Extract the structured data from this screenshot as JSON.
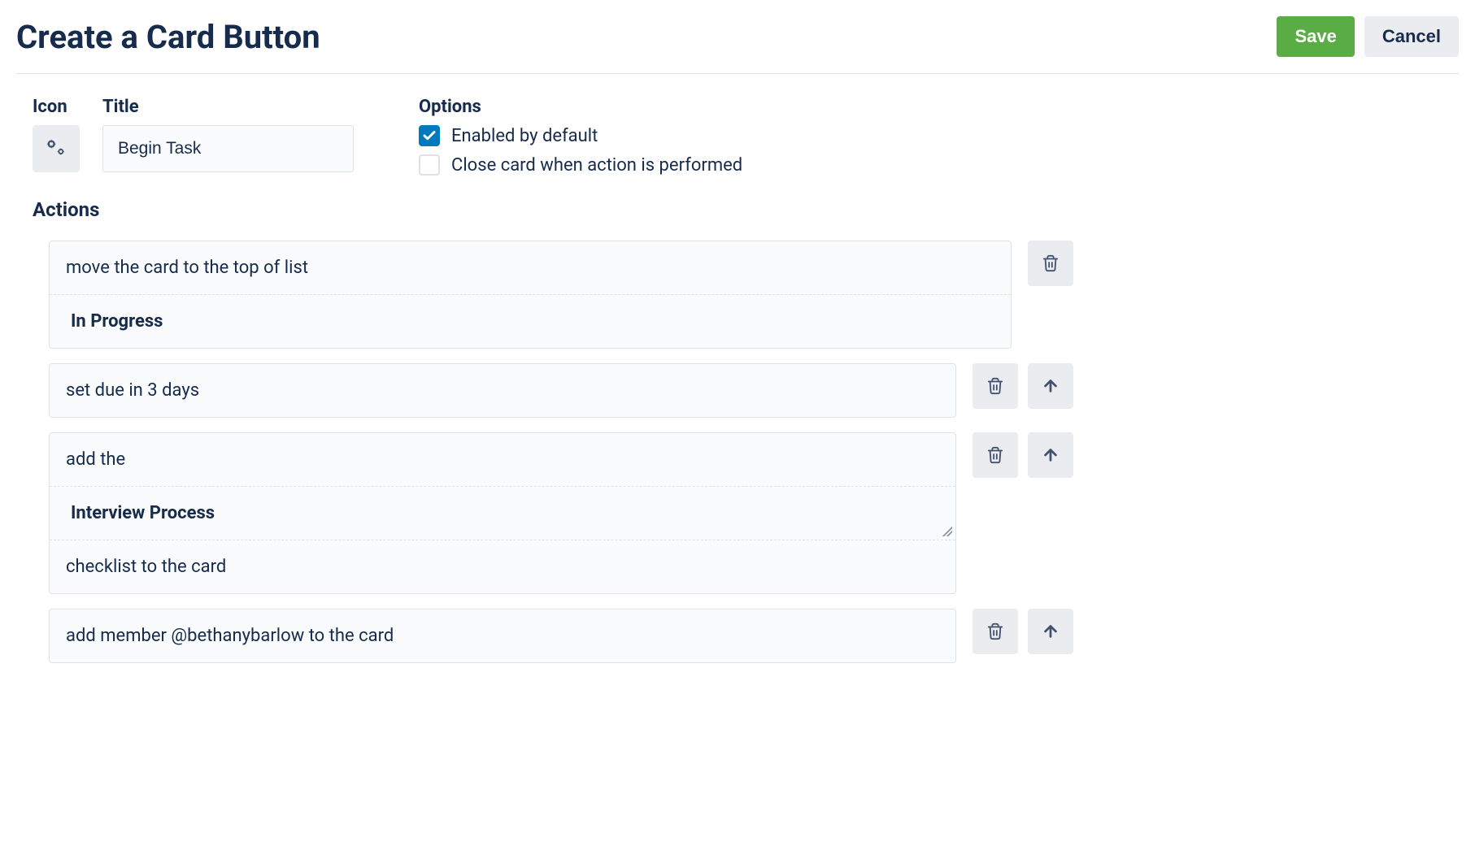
{
  "header": {
    "title": "Create a Card Button",
    "save_label": "Save",
    "cancel_label": "Cancel"
  },
  "config": {
    "icon_label": "Icon",
    "title_label": "Title",
    "title_value": "Begin Task",
    "options_label": "Options",
    "option_enabled": {
      "label": "Enabled by default",
      "checked": true
    },
    "option_close": {
      "label": "Close card when action is performed",
      "checked": false
    }
  },
  "actions_heading": "Actions",
  "actions": [
    {
      "segments": [
        {
          "text": "move the card to the top of list",
          "bold": false
        },
        {
          "text": "In Progress",
          "bold": true
        }
      ],
      "has_up": false
    },
    {
      "segments": [
        {
          "text": "set due in 3 days",
          "bold": false
        }
      ],
      "has_up": true
    },
    {
      "segments": [
        {
          "text": "add the",
          "bold": false
        },
        {
          "text": "Interview Process",
          "bold": true,
          "resize": true
        },
        {
          "text": "checklist to the card",
          "bold": false
        }
      ],
      "has_up": true
    },
    {
      "segments": [
        {
          "text": "add member @bethanybarlow to the card",
          "bold": false
        }
      ],
      "has_up": true
    }
  ]
}
